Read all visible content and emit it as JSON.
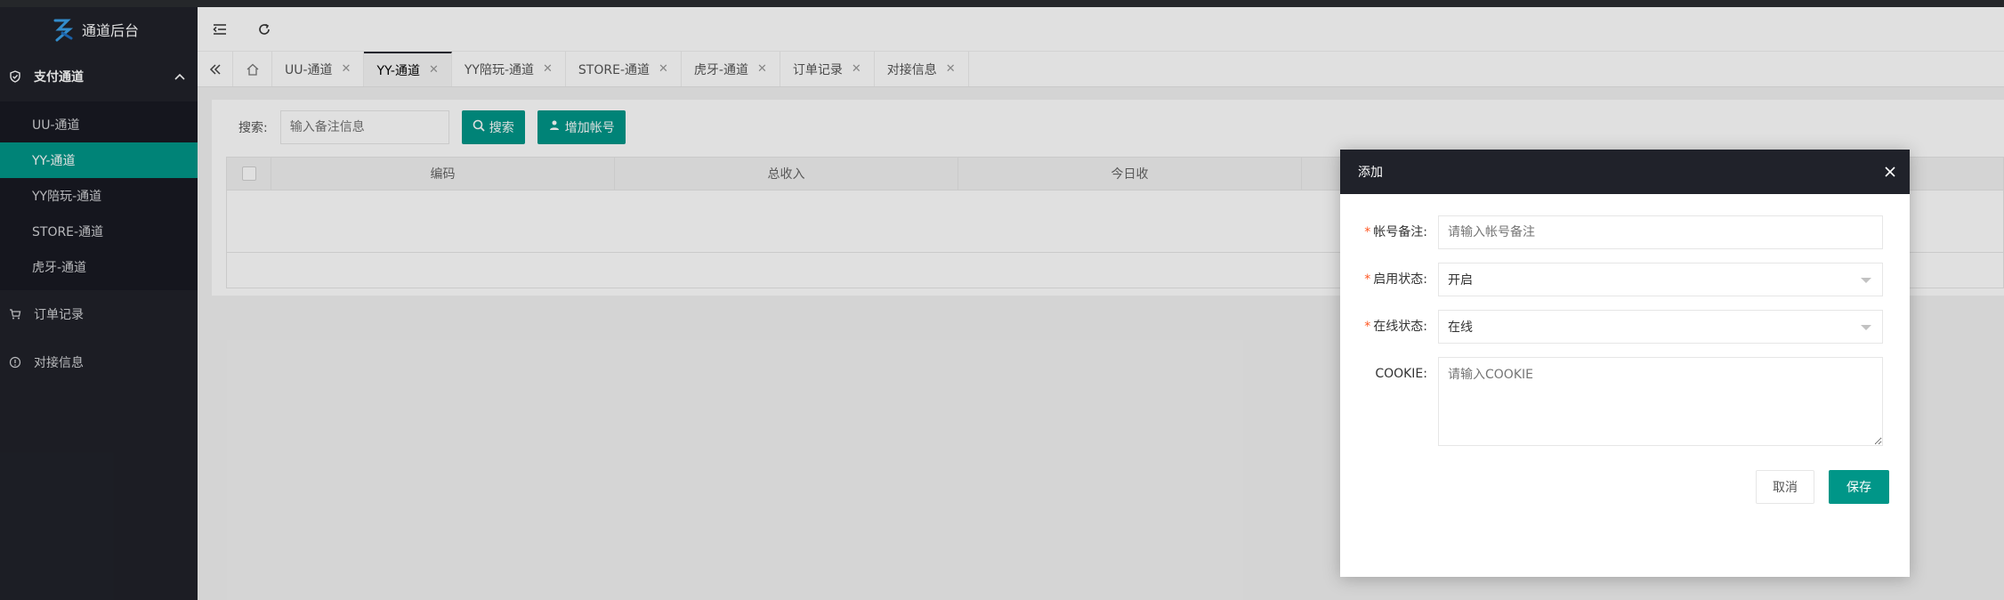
{
  "app": {
    "title": "通道后台"
  },
  "sidebar": {
    "group": {
      "label": "支付通道",
      "expanded": true
    },
    "submenu": [
      {
        "label": "UU-通道",
        "active": false
      },
      {
        "label": "YY-通道",
        "active": true
      },
      {
        "label": "YY陪玩-通道",
        "active": false
      },
      {
        "label": "STORE-通道",
        "active": false
      },
      {
        "label": "虎牙-通道",
        "active": false
      }
    ],
    "items": [
      {
        "label": "订单记录",
        "icon": "cart-icon"
      },
      {
        "label": "对接信息",
        "icon": "info-icon"
      }
    ]
  },
  "tabs": [
    {
      "label": "UU-通道",
      "active": false
    },
    {
      "label": "YY-通道",
      "active": true
    },
    {
      "label": "YY陪玩-通道",
      "active": false
    },
    {
      "label": "STORE-通道",
      "active": false
    },
    {
      "label": "虎牙-通道",
      "active": false
    },
    {
      "label": "订单记录",
      "active": false
    },
    {
      "label": "对接信息",
      "active": false
    }
  ],
  "search": {
    "label": "搜索:",
    "placeholder": "输入备注信息",
    "search_button": "搜索",
    "add_button": "增加帐号"
  },
  "table": {
    "columns": [
      "编码",
      "总收入",
      "今日收"
    ]
  },
  "modal": {
    "title": "添加",
    "fields": {
      "remark": {
        "label": "帐号备注:",
        "placeholder": "请输入帐号备注",
        "required": true
      },
      "enabled": {
        "label": "启用状态:",
        "value": "开启",
        "required": true
      },
      "online": {
        "label": "在线状态:",
        "value": "在线",
        "required": true
      },
      "cookie": {
        "label": "COOKIE:",
        "placeholder": "请输入COOKIE",
        "required": false
      }
    },
    "cancel": "取消",
    "save": "保存"
  },
  "colors": {
    "accent": "#009688",
    "sidebar": "#20222a",
    "submenu": "#191a23"
  }
}
